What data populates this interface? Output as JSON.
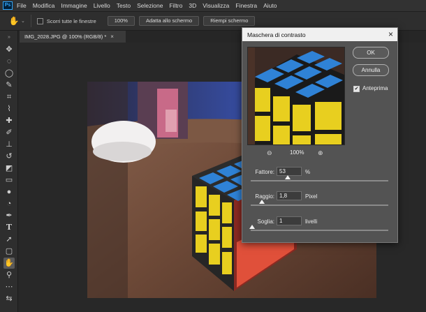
{
  "menubar": {
    "logo": "Ps",
    "items": [
      "File",
      "Modifica",
      "Immagine",
      "Livello",
      "Testo",
      "Selezione",
      "Filtro",
      "3D",
      "Visualizza",
      "Finestra",
      "Aiuto"
    ]
  },
  "options_bar": {
    "tool_icon": "hand-icon",
    "scroll_all_label": "Scorri tutte le finestre",
    "zoom_100_label": "100%",
    "fit_screen_label": "Adatta allo schermo",
    "fill_screen_label": "Riempi schermo"
  },
  "document": {
    "tab_title": "IMG_2028.JPG @ 100% (RGB/8) *",
    "close_glyph": "×"
  },
  "toolbar": {
    "tools": [
      "move-icon",
      "marquee-icon",
      "lasso-icon",
      "quick-selection-icon",
      "crop-icon",
      "eyedropper-icon",
      "healing-icon",
      "brush-icon",
      "stamp-icon",
      "history-brush-icon",
      "eraser-icon",
      "gradient-icon",
      "blur-icon",
      "dodge-icon",
      "pen-icon",
      "type-icon",
      "path-selection-icon",
      "rectangle-icon",
      "hand-icon",
      "zoom-icon",
      "more-icon",
      "swap-colors-icon"
    ],
    "active_tool": "hand-icon"
  },
  "dialog": {
    "title": "Maschera di contrasto",
    "close_glyph": "×",
    "ok_label": "OK",
    "cancel_label": "Annulla",
    "preview_label": "Anteprima",
    "preview_checked": true,
    "zoom_value": "100%",
    "amount": {
      "label": "Fattore:",
      "value": "53",
      "unit": "%",
      "level": 0.27
    },
    "radius": {
      "label": "Raggio:",
      "value": "1,8",
      "unit": "Pixel",
      "level": 0.08
    },
    "threshold": {
      "label": "Soglia:",
      "value": "1",
      "unit": "livelli",
      "level": 0.01
    }
  },
  "colors": {
    "cube_blue": "#2f82d6",
    "cube_yellow": "#e8cf1f",
    "cube_red": "#e0503a",
    "table_wood": "#7a5642"
  }
}
